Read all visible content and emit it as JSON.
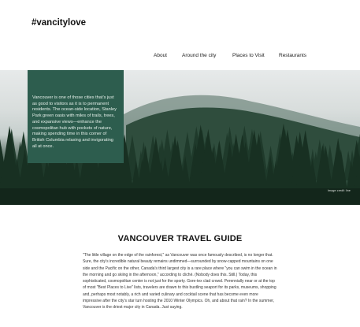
{
  "site": {
    "title": "#vancitylove"
  },
  "nav": {
    "items": [
      "About",
      "Around the city",
      "Places to Visit",
      "Restaurants"
    ]
  },
  "hero": {
    "intro": "Vancouver is one of those cities that’s just as good to visitors as it is to permanent residents. The ocean-side location, Stanley Park green oasis with miles of trails, trees, and expansive views—enhance the cosmopolitan hub with pockets of nature, making spending time in this corner of British Columbia relaxing and invigorating all at once.",
    "credit": "Image credit line"
  },
  "guide": {
    "title": "VANCOUVER TRAVEL GUIDE",
    "body": "\"The little village on the edge of the rainforest,\" as Vancouver was once famously described, is no longer that. Sure, the city's incredible natural beauty remains undimmed—surrounded by snow-capped mountains on one side and the Pacific on the other, Canada's third largest city is a rare place where \"you can swim in the ocean in the morning and go skiing in the afternoon,\" according to cliché. (Nobody does this. Still.) Today, this sophisticated, cosmopolitan center is not just for the sporty. Gore-tex clad crowd. Perennially near or at the top of most \"Best Places to Live\" lists, travelers are drawn to this bustling seaport for its parks, museums, shopping and, perhaps most notably, a rich and varied culinary and cocktail scene that has become even more impressive after the city's star turn hosting the 2010 Winter Olympics. Oh, and about that rain? In the summer, Vancouver is the driest major city in Canada. Just saying."
  },
  "colors": {
    "intro_box": "#2d5d4e",
    "forest_dark": "#1c3326",
    "sky": "#e7eaea"
  }
}
